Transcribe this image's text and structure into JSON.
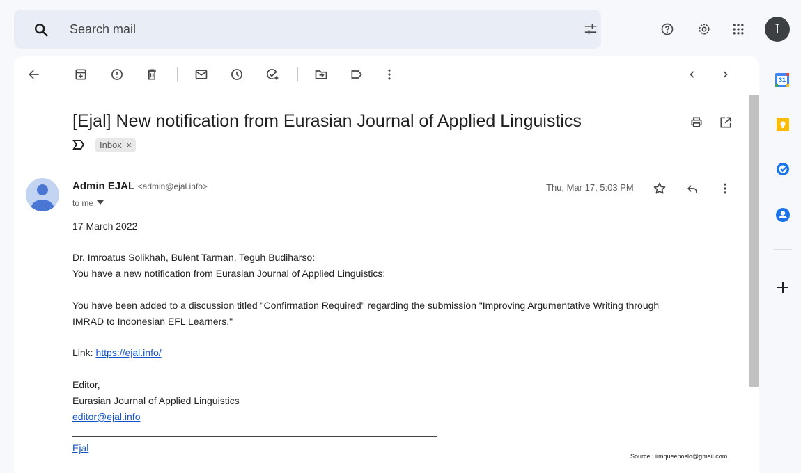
{
  "search": {
    "placeholder": "Search mail"
  },
  "account": {
    "initial": "I"
  },
  "message": {
    "subject": "[Ejal] New notification from Eurasian Journal of Applied Linguistics",
    "label_chip": "Inbox",
    "label_chip_close": "×",
    "sender_name": "Admin EJAL",
    "sender_email": "<admin@ejal.info>",
    "recipient": "to me",
    "date": "Thu, Mar 17, 5:03 PM",
    "body": {
      "date_line": "17 March 2022",
      "greeting": "Dr. Imroatus Solikhah, Bulent Tarman, Teguh Budiharso:",
      "intro": "You have a new notification from Eurasian Journal of Applied Linguistics:",
      "para1_line1": "You have been added to a discussion titled \"Confirmation Required\" regarding the submission \"Improving Argumentative Writing through",
      "para1_line2": "IMRAD to Indonesian EFL Learners.\"",
      "link_label": "Link: ",
      "link_url": "https://ejal.info/",
      "sig_role": "Editor,",
      "sig_org": "Eurasian Journal of Applied Linguistics",
      "sig_email": "editor@ejal.info",
      "footer_link": "Ejal"
    }
  },
  "source_note": "Source : iimqueenoslo@gmail.com",
  "side_panel": {
    "calendar_day": "31"
  }
}
